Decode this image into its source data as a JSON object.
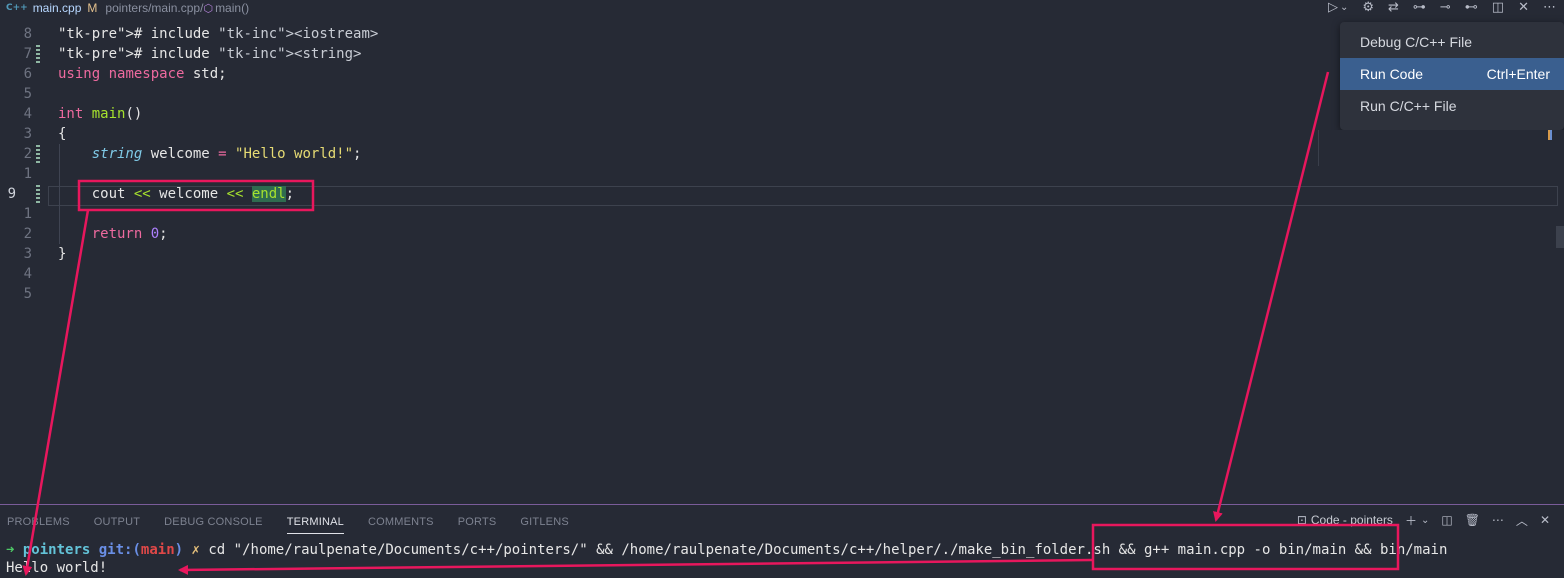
{
  "breadcrumb": {
    "file_icon": "C++",
    "file_name": "main.cpp",
    "modified": "M",
    "path": "pointers/main.cpp/",
    "symbol": "main()"
  },
  "toolbar": {
    "icons": [
      "run-icon",
      "chevron-down-icon",
      "gear-icon",
      "compare-icon",
      "git-commit-icon",
      "git-prev-icon",
      "git-next-icon",
      "split-editor-icon",
      "close-icon",
      "more-icon"
    ]
  },
  "editor": {
    "lines": [
      {
        "num": "8",
        "text": "# include <iostream>"
      },
      {
        "num": "7",
        "text": "# include <string>"
      },
      {
        "num": "6",
        "text": "using namespace std;"
      },
      {
        "num": "5",
        "text": ""
      },
      {
        "num": "4",
        "text": "int main()"
      },
      {
        "num": "3",
        "text": "{"
      },
      {
        "num": "2",
        "text": "    string welcome = \"Hello world!\";"
      },
      {
        "num": "1",
        "text": ""
      },
      {
        "num": "9",
        "text": "    cout << welcome << endl;"
      },
      {
        "num": "1",
        "text": ""
      },
      {
        "num": "2",
        "text": "    return 0;"
      },
      {
        "num": "3",
        "text": "}"
      },
      {
        "num": "4",
        "text": ""
      },
      {
        "num": "5",
        "text": ""
      }
    ]
  },
  "run_menu": {
    "items": [
      {
        "label": "Debug C/C++ File",
        "shortcut": ""
      },
      {
        "label": "Run Code",
        "shortcut": "Ctrl+Enter"
      },
      {
        "label": "Run C/C++ File",
        "shortcut": ""
      }
    ],
    "active_index": 1
  },
  "panel": {
    "tabs": [
      "PROBLEMS",
      "OUTPUT",
      "DEBUG CONSOLE",
      "TERMINAL",
      "COMMENTS",
      "PORTS",
      "GITLENS"
    ],
    "active_tab": "TERMINAL",
    "terminal_name": "Code - pointers"
  },
  "terminal": {
    "prompt_arrow": "➜",
    "dir": "pointers",
    "git_label": "git:(",
    "branch": "main",
    "git_close": ")",
    "dirty_mark": "✗",
    "command": "cd \"/home/raulpenate/Documents/c++/pointers/\" && /home/raulpenate/Documents/c++/helper/./make_bin_folder.sh && g++ main.cpp -o bin/main && bin/main",
    "output": "Hello world!"
  },
  "colors": {
    "annotation": "#e8175d",
    "editor_bg": "#262a35",
    "menu_active": "#3a5f8f"
  }
}
